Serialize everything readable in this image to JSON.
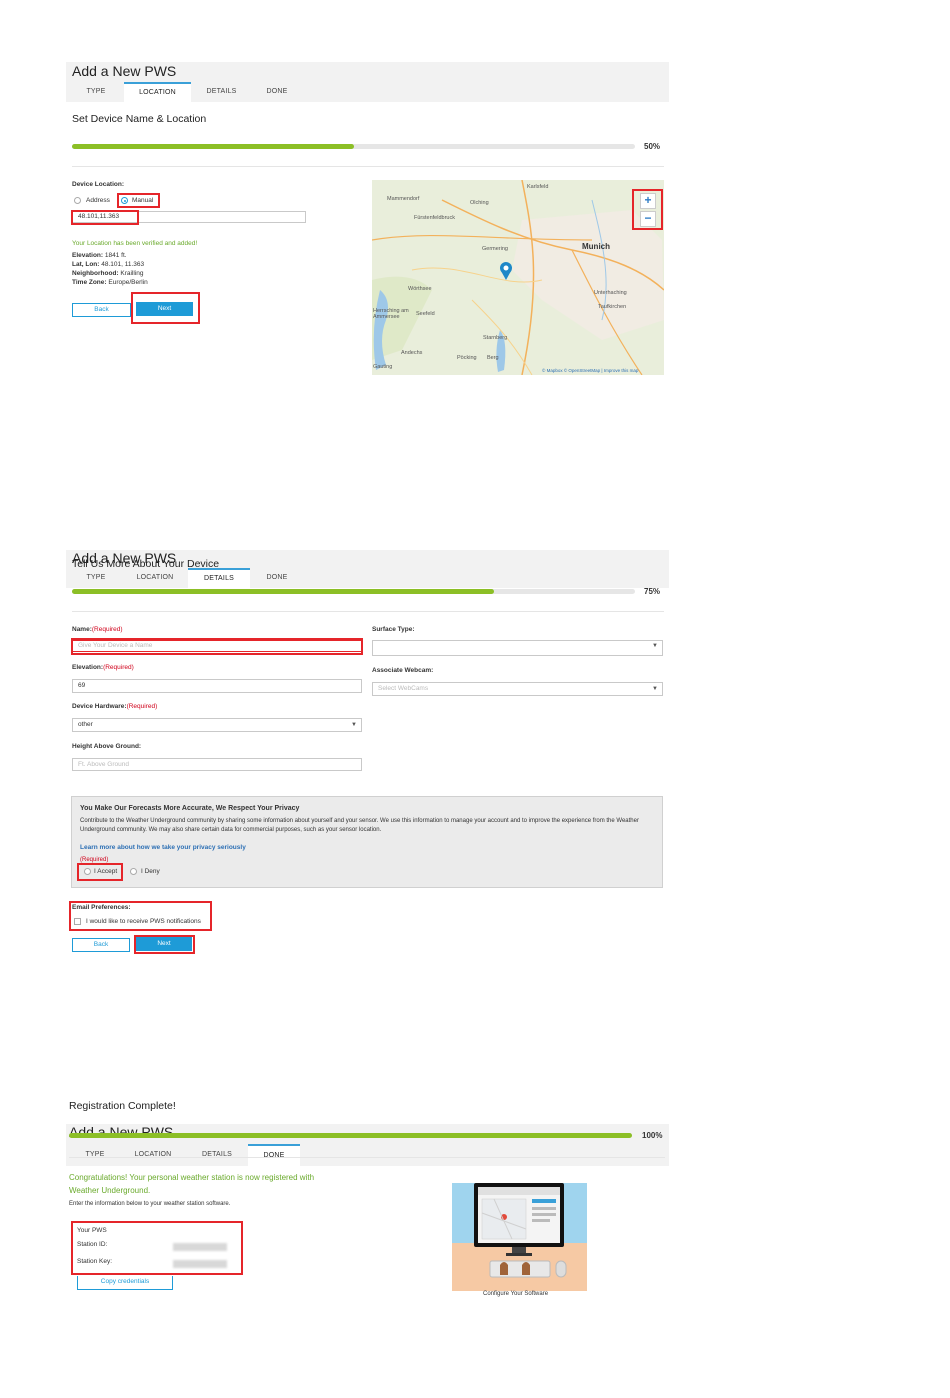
{
  "tabs": {
    "type": "TYPE",
    "location": "LOCATION",
    "details": "DETAILS",
    "done": "DONE"
  },
  "step1": {
    "title": "Add a New PWS",
    "section": "Set Device Name & Location",
    "progress": 0.5,
    "progress_label": "50%",
    "device_location_label": "Device Location:",
    "radio_address": "Address",
    "radio_manual": "Manual",
    "coords_value": "48.101,11.363",
    "verified_msg": "Your Location has been verified and added!",
    "elevation_label": "Elevation:",
    "elevation_value": "1841 ft.",
    "latlon_label": "Lat, Lon:",
    "latlon_value": "48.101, 11.363",
    "neighborhood_label": "Neighborhood:",
    "neighborhood_value": "Krailling",
    "timezone_label": "Time Zone:",
    "timezone_value": "Europe/Berlin",
    "back": "Back",
    "next": "Next",
    "map": {
      "labels": [
        "Karlsfeld",
        "Mammendorf",
        "Olching",
        "Fürstenfeldbruck",
        "Germering",
        "Wörthsee",
        "Unterhaching",
        "Taufkirchen",
        "Herrsching am Ammersee",
        "Seefeld",
        "Starnberg",
        "Andechs",
        "Pöcking",
        "Berg",
        "Gauting"
      ],
      "city": "Munich",
      "zoom_in": "+",
      "zoom_out": "−",
      "attribution": "© Mapbox © OpenStreetMap | Improve this map"
    }
  },
  "step2": {
    "title": "Add a New PWS",
    "section": "Tell Us More About Your Device",
    "progress": 0.75,
    "progress_label": "75%",
    "name_label": "Name:",
    "name_req": "(Required)",
    "name_placeholder": "Give Your Device a Name",
    "surface_label": "Surface Type:",
    "elevation_label": "Elevation:",
    "elevation_req": "(Required)",
    "elevation_value": "69",
    "webcam_label": "Associate Webcam:",
    "webcam_placeholder": "Select WebCams",
    "hardware_label": "Device Hardware:",
    "hardware_req": "(Required)",
    "hardware_value": "other",
    "height_label": "Height Above Ground:",
    "height_placeholder": "Ft. Above Ground",
    "privacy_title": "You Make Our Forecasts More Accurate, We Respect Your Privacy",
    "privacy_body": "Contribute to the Weather Underground community by sharing some information about yourself and your sensor. We use this information to manage your account and to improve the experience from the Weather Underground community. We may also share certain data for commercial purposes, such as your sensor location.",
    "privacy_link": "Learn more about how we take your privacy seriously",
    "privacy_req": "(Required)",
    "accept": "I Accept",
    "deny": "I Deny",
    "email_label": "Email Preferences:",
    "email_option": "I would like to receive PWS notifications",
    "back": "Back",
    "next": "Next"
  },
  "step3": {
    "title": "Add a New PWS",
    "section": "Registration Complete!",
    "progress": 1.0,
    "progress_label": "100%",
    "congrats_line1": "Congratulations! Your personal weather station is now registered with",
    "congrats_line2": "Weather Underground.",
    "instruction": "Enter the information below to your weather station software.",
    "cred_title": "Your PWS",
    "station_id_label": "Station ID:",
    "station_key_label": "Station Key:",
    "copy_btn": "Copy credentials",
    "illustration_caption": "Configure Your Software"
  },
  "colors": {
    "accent": "#1e9bd7",
    "progress": "#8cbf26",
    "success": "#6aaa2c",
    "required": "#d0021b",
    "highlight": "#e5252a"
  }
}
